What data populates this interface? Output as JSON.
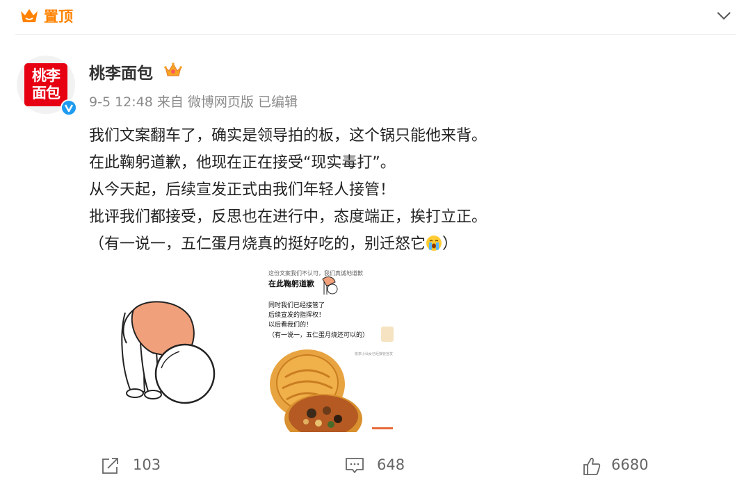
{
  "header": {
    "pin_label": "置顶"
  },
  "post": {
    "avatar_text_line1": "桃李",
    "avatar_text_line2": "面包",
    "username": "桃李面包",
    "meta": "9-5 12:48 来自 微博网页版 已编辑",
    "lines": [
      "我们文案翻车了，确实是领导拍的板，这个锅只能他来背。",
      "在此鞠躬道歉，他现在正在接受“现实毒打”。",
      "从今天起，后续宣发正式由我们年轻人接管！",
      "批评我们都接受，反思也在进行中，态度端正，挨打立正。",
      "（有一说一，五仁蛋月烧真的挺好吃的，别迁怒它"
    ],
    "last_line_end": "）"
  },
  "image2": {
    "line_top": "这份文案我们不认可，我们真诚地道歉",
    "line_title": "在此鞠躬道歉",
    "line1": "同时我们已经接管了",
    "line2": "后续宣发的指挥权！",
    "line3": "以后看我们的！",
    "line4": "（有一说一，五仁蛋月烧还可以的）",
    "line_small": "桃李小仙女已经接管宣发"
  },
  "actions": {
    "share_count": "103",
    "comment_count": "648",
    "like_count": "6680"
  },
  "colors": {
    "brand": "#ff8200",
    "avatar_red": "#e60012",
    "verified": "#1f9bf0"
  },
  "icons": [
    "pin-crown-icon",
    "chevron-down-icon",
    "verified-icon",
    "crown-icon",
    "crying-emoji-icon",
    "share-icon",
    "comment-icon",
    "like-icon"
  ]
}
